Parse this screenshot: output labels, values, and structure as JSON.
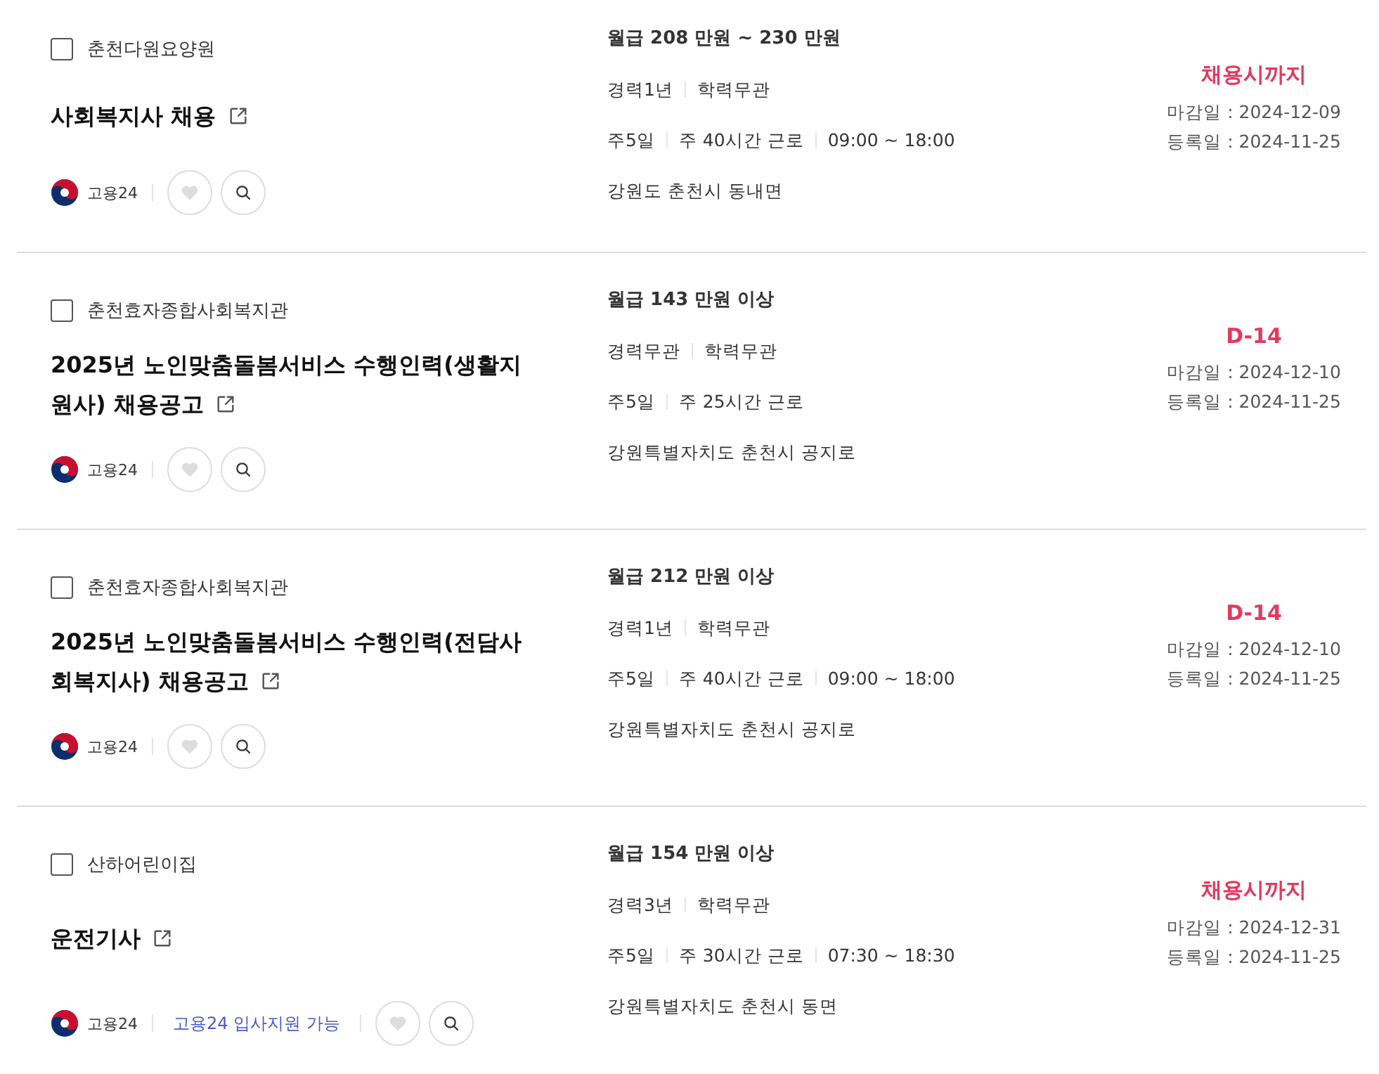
{
  "jobs": [
    {
      "company": "춘천다원요양원",
      "checked": false,
      "title": "사회복지사 채용",
      "source": "고용24",
      "salary": "월급 208 만원 ~ 230 만원",
      "requirements": [
        "경력1년",
        "학력무관"
      ],
      "schedule": [
        "주5일",
        "주 40시간 근로",
        "09:00 ~ 18:00"
      ],
      "location": "강원도 춘천시 동내면",
      "status": "채용시까지",
      "deadline": "마감일 : 2024-12-09",
      "registered": "등록일 : 2024-11-25"
    },
    {
      "company": "춘천효자종합사회복지관",
      "checked": false,
      "title": "2025년 노인맞춤돌봄서비스 수행인력(생활지원사) 채용공고",
      "source": "고용24",
      "salary": "월급 143 만원 이상",
      "requirements": [
        "경력무관",
        "학력무관"
      ],
      "schedule": [
        "주5일",
        "주 25시간 근로"
      ],
      "location": "강원특별자치도 춘천시 공지로",
      "status": "D-14",
      "deadline": "마감일 : 2024-12-10",
      "registered": "등록일 : 2024-11-25"
    },
    {
      "company": "춘천효자종합사회복지관",
      "checked": false,
      "title": "2025년 노인맞춤돌봄서비스 수행인력(전담사회복지사) 채용공고",
      "source": "고용24",
      "salary": "월급 212 만원 이상",
      "requirements": [
        "경력1년",
        "학력무관"
      ],
      "schedule": [
        "주5일",
        "주 40시간 근로",
        "09:00 ~ 18:00"
      ],
      "location": "강원특별자치도 춘천시 공지로",
      "status": "D-14",
      "deadline": "마감일 : 2024-12-10",
      "registered": "등록일 : 2024-11-25"
    },
    {
      "company": "산하어린이집",
      "checked": false,
      "title": "운전기사",
      "source": "고용24",
      "apply_note": "고용24 입사지원 가능",
      "salary": "월급 154 만원 이상",
      "requirements": [
        "경력3년",
        "학력무관"
      ],
      "schedule": [
        "주5일",
        "주 30시간 근로",
        "07:30 ~ 18:30"
      ],
      "location": "강원특별자치도 춘천시 동면",
      "status": "채용시까지",
      "deadline": "마감일 : 2024-12-31",
      "registered": "등록일 : 2024-11-25"
    }
  ]
}
